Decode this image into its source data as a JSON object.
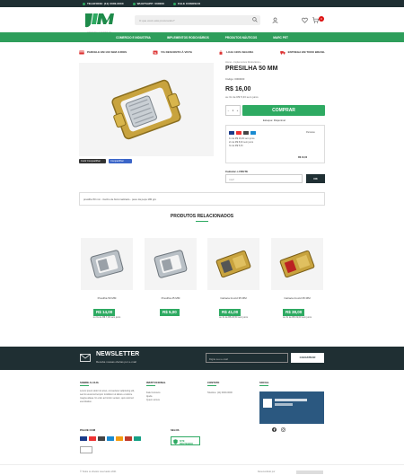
{
  "topbar": {
    "phone": "TELEFONE: (11) 0000-0000",
    "whatsapp": "WHATSAPP: 000000",
    "contact": "FALE CONOSCO"
  },
  "header": {
    "logo_text": "ALFA MOTORS",
    "logo_sub": "MATERIAIS DE AMARRAÇÃO",
    "search_placeholder": "O que você está procurando?",
    "cart_count": "0"
  },
  "nav": [
    "COMERCIO E INDUSTRIA",
    "IMPLEMENTOS RODOVIÁRIOS",
    "PRODUTOS NÁUTICOS",
    "MARC PET"
  ],
  "benefits": [
    "PARCELE EM 10X SEM JUROS",
    "5% DESCONTO À VISTA",
    "LOJA 100% SEGURA",
    "ENTREGA EM TODO BRASIL"
  ],
  "product": {
    "breadcrumb": "Home › Implementos Rodoviários ›",
    "title": "PRESILHA 50 MM",
    "code": "Código: 0000000",
    "price": "R$ 16,00",
    "old_price": "ou 3x de R$ 5,33 sem juros",
    "qty": "1",
    "buy_label": "COMPRAR",
    "stock": "Estoque: Disponível",
    "installments": [
      "1x de R$ 16,00 sem juros",
      "2x de R$ 8,00 sem juros",
      "3x de R$ 5,33"
    ],
    "installment_side": "R$ 16,00",
    "pay_label": "Parcelas",
    "cep_label": "Calcular o FRETE",
    "cep_placeholder": "CEP",
    "cep_button": "OK",
    "share_labels": [
      "Curtir Compartilhar",
      "Compartilhar"
    ],
    "description": "presilha 50 mm - banho de bicromatizado - peso da peça 180 grs"
  },
  "related": {
    "title": "PRODUTOS RELACIONADOS",
    "items": [
      {
        "name": "Presilha 50 MM",
        "price": "R$ 14,00",
        "old": "ou 3x de R$ 7,00 sem juros"
      },
      {
        "name": "Presilha 25 MM",
        "price": "R$ 5,00",
        "old": ""
      },
      {
        "name": "Catraca Inoxid 35 MM",
        "price": "R$ 41,00",
        "old": "ou 3x de R$ 20,50 sem juros"
      },
      {
        "name": "Catraca Inoxid 35 MM",
        "price": "R$ 38,00",
        "old": "ou 3x de R$ 19,00 sem juros"
      }
    ]
  },
  "newsletter": {
    "title": "NEWSLETTER",
    "subtitle": "Receba nossas ofertas por e-mail",
    "placeholder": "Digite seu e-mail",
    "button": "CADASTRAR"
  },
  "footer": {
    "about_title": "SOBRE A LOJA",
    "about_text": "Lorem ipsum dolor sit amet, consectetur adipiscing elit, sed do eiusmod tempor incididunt ut labore et dolore magna aliqua. Ut enim ad minim veniam, quis nostrud exercitation.",
    "inst_title": "INSTITUCIONAL",
    "inst_items": [
      "Fale Conosco",
      "Ajuda",
      "Quem somos"
    ],
    "contact_title": "CONTATO",
    "contact_phone": "Telefone: (11) 0000-0000",
    "social_title": "SOCIAL",
    "payment_title": "PAGUE COM",
    "security_title": "SELOS",
    "seal_label": "SITE PROTEGIDO",
    "copyright": "© Todos os direitos reservados 2021",
    "credits": "Desenvolvido por"
  },
  "colors": {
    "green": "#2eaa62",
    "dark": "#1f2f33"
  }
}
